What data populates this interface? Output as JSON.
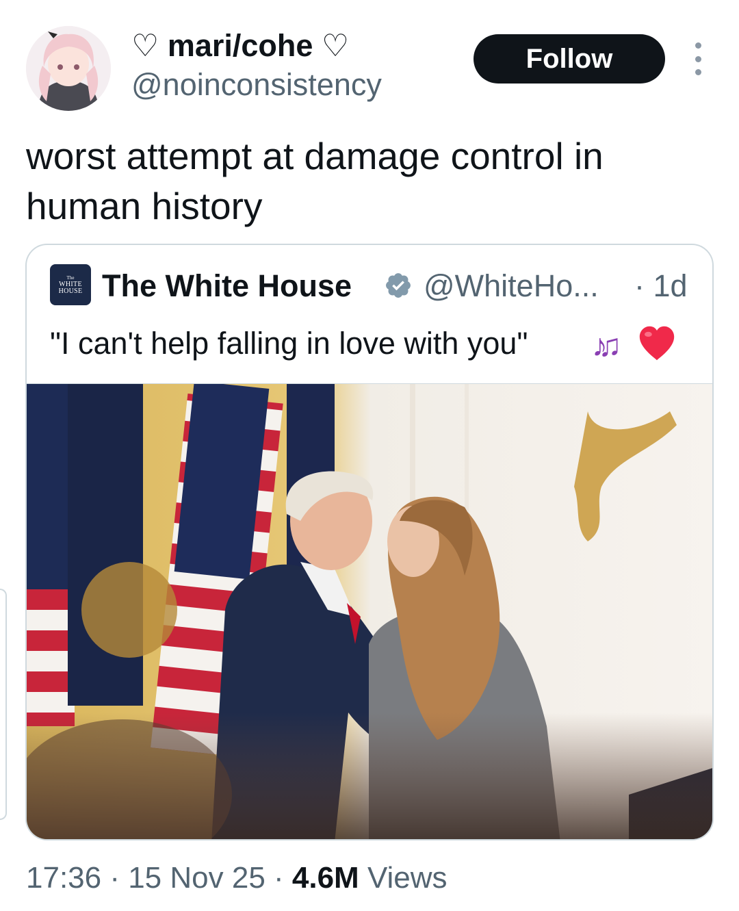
{
  "post": {
    "author": {
      "display_name": "♡ mari/cohe ♡",
      "handle": "@noinconsistency"
    },
    "follow_label": "Follow",
    "text": "worst attempt at damage control in human history",
    "timestamp": "17:36 · 15 Nov 25 · ",
    "views_count": "4.6M",
    "views_label": " Views"
  },
  "quote": {
    "logo": {
      "line1": "The",
      "line2": "WHITE",
      "line3": "HOUSE"
    },
    "author_name": "The White House",
    "handle": "@WhiteHo...",
    "time": "· 1d",
    "text": "\"I can't help falling in love with you\"",
    "emoji": "🎶❤️"
  },
  "icons": {
    "more": "more-vertical-icon",
    "verified": "verified-badge-icon",
    "music": "musical-notes-icon",
    "heart": "red-heart-icon"
  },
  "colors": {
    "text_primary": "#0f1419",
    "text_secondary": "#536471",
    "border": "#cfd9de",
    "follow_bg": "#0f1419",
    "verified_badge": "#829aab",
    "heart": "#f0294a",
    "music": "#8a3fb3"
  }
}
